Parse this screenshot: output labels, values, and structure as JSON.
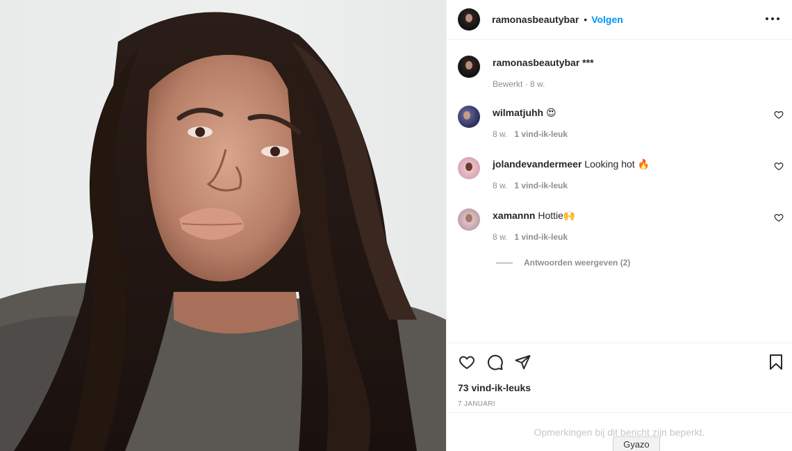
{
  "post": {
    "author": "ramonasbeautybar",
    "follow_label": "Volgen",
    "dot": "•",
    "caption": {
      "username": "ramonasbeautybar",
      "text": "***",
      "meta": "Bewerkt · 8 w."
    },
    "comments": [
      {
        "username": "wilmatjuhh",
        "text": "😍",
        "time": "8 w.",
        "likes": "1 vind-ik-leuk"
      },
      {
        "username": "jolandevandermeer",
        "text": "Looking hot 🔥",
        "time": "8 w.",
        "likes": "1 vind-ik-leuk"
      },
      {
        "username": "xamannn",
        "text": "Hottie🙌",
        "time": "8 w.",
        "likes": "1 vind-ik-leuk"
      }
    ],
    "view_replies": "Antwoorden weergeven (2)",
    "likes_count": "73 vind-ik-leuks",
    "date": "7 JANUARI",
    "comments_restricted": "Opmerkingen bij dit bericht zijn beperkt."
  },
  "overlay": {
    "gyazo_label": "Gyazo"
  },
  "icons": [
    "more-icon",
    "heart-icon",
    "comment-icon",
    "share-icon",
    "bookmark-icon"
  ],
  "colors": {
    "accent": "#0095f6",
    "muted": "#8e8e8e",
    "text": "#262626"
  }
}
